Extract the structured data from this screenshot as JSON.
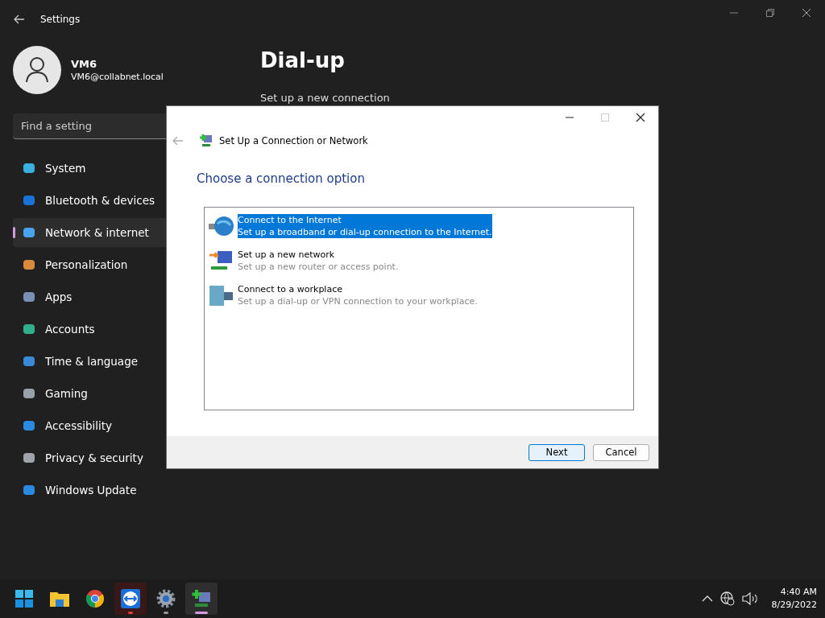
{
  "settings": {
    "title": "Settings",
    "user": {
      "name": "VM6",
      "email": "VM6@collabnet.local"
    },
    "search": {
      "placeholder": "Find a setting"
    },
    "nav": [
      {
        "label": "System",
        "selected": false
      },
      {
        "label": "Bluetooth & devices",
        "selected": false
      },
      {
        "label": "Network & internet",
        "selected": true
      },
      {
        "label": "Personalization",
        "selected": false
      },
      {
        "label": "Apps",
        "selected": false
      },
      {
        "label": "Accounts",
        "selected": false
      },
      {
        "label": "Time & language",
        "selected": false
      },
      {
        "label": "Gaming",
        "selected": false
      },
      {
        "label": "Accessibility",
        "selected": false
      },
      {
        "label": "Privacy & security",
        "selected": false
      },
      {
        "label": "Windows Update",
        "selected": false
      }
    ],
    "page_title": "Dial-up",
    "section": "Set up a new connection"
  },
  "dialog": {
    "title": "Set Up a Connection or Network",
    "heading": "Choose a connection option",
    "options": [
      {
        "title": "Connect to the Internet",
        "description": "Set up a broadband or dial-up connection to the Internet.",
        "selected": true
      },
      {
        "title": "Set up a new network",
        "description": "Set up a new router or access point.",
        "selected": false
      },
      {
        "title": "Connect to a workplace",
        "description": "Set up a dial-up or VPN connection to your workplace.",
        "selected": false
      }
    ],
    "buttons": [
      {
        "label": "Next",
        "default": true
      },
      {
        "label": "Cancel",
        "default": false
      }
    ]
  },
  "taskbar": {
    "apps": [
      {
        "running": false,
        "focused": false,
        "alert": false
      },
      {
        "running": false,
        "focused": false,
        "alert": false
      },
      {
        "running": false,
        "focused": false,
        "alert": false
      },
      {
        "running": true,
        "focused": false,
        "alert": true
      },
      {
        "running": true,
        "focused": false,
        "alert": false
      },
      {
        "running": true,
        "focused": true,
        "alert": false
      }
    ],
    "time": "4:40 AM",
    "date": "8/29/2022"
  }
}
